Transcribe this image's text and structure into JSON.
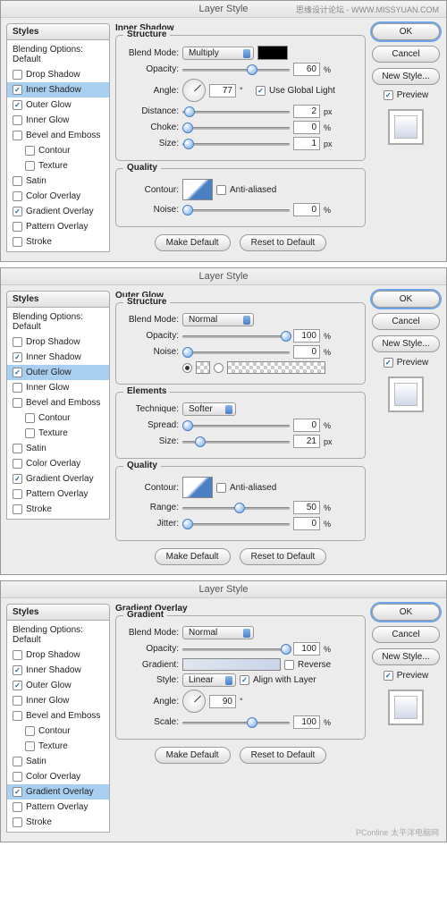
{
  "common": {
    "title": "Layer Style",
    "stylesHdr": "Styles",
    "blendOpts": "Blending Options: Default",
    "effects": [
      "Drop Shadow",
      "Inner Shadow",
      "Outer Glow",
      "Inner Glow",
      "Bevel and Emboss",
      "Contour",
      "Texture",
      "Satin",
      "Color Overlay",
      "Gradient Overlay",
      "Pattern Overlay",
      "Stroke"
    ],
    "ok": "OK",
    "cancel": "Cancel",
    "newStyle": "New Style...",
    "preview": "Preview",
    "makeDefault": "Make Default",
    "resetDefault": "Reset to Default",
    "labels": {
      "blendMode": "Blend Mode:",
      "opacity": "Opacity:",
      "angle": "Angle:",
      "distance": "Distance:",
      "choke": "Choke:",
      "size": "Size:",
      "contour": "Contour:",
      "noise": "Noise:",
      "useGlobal": "Use Global Light",
      "antialias": "Anti-aliased",
      "technique": "Technique:",
      "spread": "Spread:",
      "range": "Range:",
      "jitter": "Jitter:",
      "gradient": "Gradient:",
      "style": "Style:",
      "scale": "Scale:",
      "reverse": "Reverse",
      "alignLayer": "Align with Layer"
    }
  },
  "panel1": {
    "header": "Inner Shadow",
    "structure": "Structure",
    "quality": "Quality",
    "blendMode": "Multiply",
    "opacity": "60",
    "angle": "77",
    "distance": "2",
    "choke": "0",
    "size": "1",
    "noise": "0",
    "checked": {
      "innerShadow": true,
      "outerGlow": true,
      "gradientOverlay": true,
      "useGlobal": true,
      "antialias": false
    },
    "selected": "Inner Shadow"
  },
  "panel2": {
    "header": "Outer Glow",
    "structure": "Structure",
    "elements": "Elements",
    "quality": "Quality",
    "blendMode": "Normal",
    "opacity": "100",
    "noise": "0",
    "technique": "Softer",
    "spread": "0",
    "size": "21",
    "range": "50",
    "jitter": "0",
    "checked": {
      "innerShadow": true,
      "outerGlow": true,
      "gradientOverlay": true,
      "antialias": false
    },
    "selected": "Outer Glow"
  },
  "panel3": {
    "header": "Gradient Overlay",
    "gradient": "Gradient",
    "blendMode": "Normal",
    "opacity": "100",
    "style": "Linear",
    "angle": "90",
    "scale": "100",
    "checked": {
      "innerShadow": true,
      "outerGlow": true,
      "gradientOverlay": true,
      "reverse": false,
      "alignLayer": true
    },
    "selected": "Gradient Overlay"
  },
  "watermark1": "思缘设计论坛 - WWW.MISSYUAN.COM",
  "watermark2": "PConline 太平洋电脑网"
}
